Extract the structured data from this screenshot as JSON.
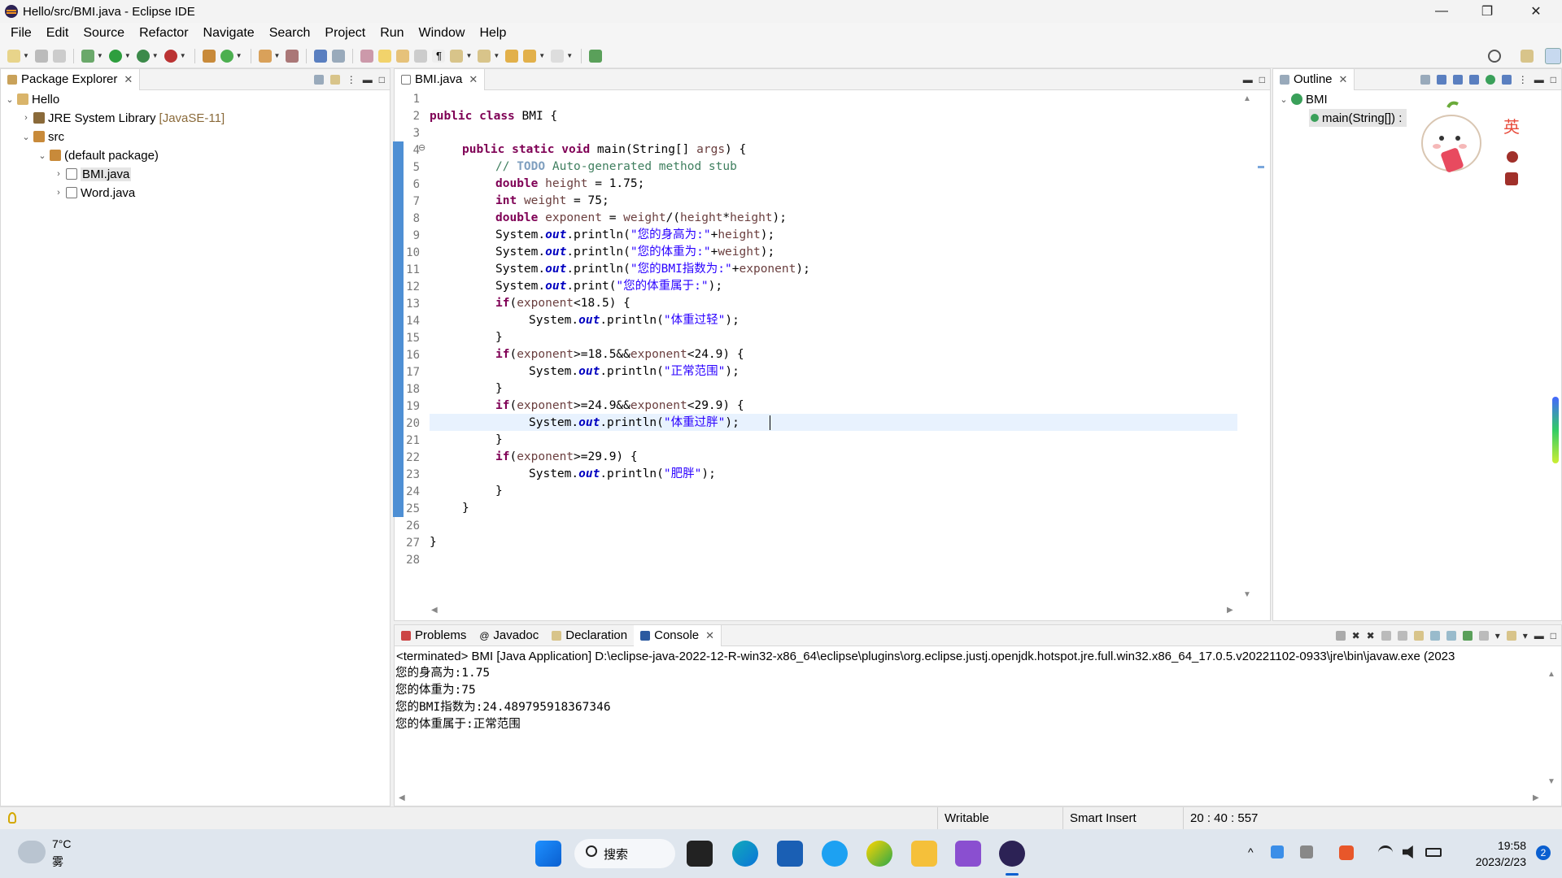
{
  "window": {
    "title": "Hello/src/BMI.java - Eclipse IDE",
    "minimize": "—",
    "restore": "❐",
    "close": "✕"
  },
  "menu": [
    "File",
    "Edit",
    "Source",
    "Refactor",
    "Navigate",
    "Search",
    "Project",
    "Run",
    "Window",
    "Help"
  ],
  "package_explorer": {
    "tab_label": "Package Explorer",
    "tree": [
      {
        "label": "Hello",
        "decoration": ""
      },
      {
        "label": "JRE System Library",
        "decoration": "[JavaSE-11]"
      },
      {
        "label": "src",
        "decoration": ""
      },
      {
        "label": "(default package)",
        "decoration": ""
      },
      {
        "label": "BMI.java",
        "decoration": ""
      },
      {
        "label": "Word.java",
        "decoration": ""
      }
    ]
  },
  "editor": {
    "tab_label": "BMI.java",
    "line_numbers": [
      "1",
      "2",
      "3",
      "4",
      "5",
      "6",
      "7",
      "8",
      "9",
      "10",
      "11",
      "12",
      "13",
      "14",
      "15",
      "16",
      "17",
      "18",
      "19",
      "20",
      "21",
      "22",
      "23",
      "24",
      "25",
      "26",
      "27",
      "28"
    ],
    "fold_marker": "⊖",
    "code": {
      "l2": [
        "public",
        "class",
        "BMI {"
      ],
      "l4": [
        "public",
        "static",
        "void",
        "main(String[] ",
        "args",
        ") {"
      ],
      "l5": [
        "// ",
        "TODO",
        " Auto-generated method stub"
      ],
      "l6": [
        "double",
        "height",
        " = 1.75;"
      ],
      "l7": [
        "int",
        "weight",
        " = 75;"
      ],
      "l8": [
        "double",
        "exponent",
        " = ",
        "weight",
        "/(",
        "height",
        "*",
        "height",
        ");"
      ],
      "l9": [
        "System.",
        "out",
        ".println(",
        "\"您的身高为:\"",
        "+",
        "height",
        ");"
      ],
      "l10": [
        "System.",
        "out",
        ".println(",
        "\"您的体重为:\"",
        "+",
        "weight",
        ");"
      ],
      "l11": [
        "System.",
        "out",
        ".println(",
        "\"您的BMI指数为:\"",
        "+",
        "exponent",
        ");"
      ],
      "l12": [
        "System.",
        "out",
        ".print(",
        "\"您的体重属于:\"",
        ");"
      ],
      "l13": [
        "if",
        "(",
        "exponent",
        "<18.5) {"
      ],
      "l14": [
        "System.",
        "out",
        ".println(",
        "\"体重过轻\"",
        ");"
      ],
      "l15": "}",
      "l16": [
        "if",
        "(",
        "exponent",
        ">=18.5&&",
        "exponent",
        "<24.9) {"
      ],
      "l17": [
        "System.",
        "out",
        ".println(",
        "\"正常范围\"",
        ");"
      ],
      "l18": "}",
      "l19": [
        "if",
        "(",
        "exponent",
        ">=24.9&&",
        "exponent",
        "<29.9) {"
      ],
      "l20": [
        "System.",
        "out",
        ".println(",
        "\"体重过胖\"",
        ");"
      ],
      "l21": "}",
      "l22": [
        "if",
        "(",
        "exponent",
        ">=29.9) {"
      ],
      "l23": [
        "System.",
        "out",
        ".println(",
        "\"肥胖\"",
        ");"
      ],
      "l24": "}",
      "l25": "}",
      "l27": "}"
    }
  },
  "outline": {
    "tab_label": "Outline",
    "class_name": "BMI",
    "method": "main(String[]) :",
    "ime_label": "英"
  },
  "bottom_tabs": {
    "problems": "Problems",
    "javadoc": "Javadoc",
    "declaration": "Declaration",
    "console": "Console"
  },
  "console": {
    "header": "<terminated> BMI [Java Application] D:\\eclipse-java-2022-12-R-win32-x86_64\\eclipse\\plugins\\org.eclipse.justj.openjdk.hotspot.jre.full.win32.x86_64_17.0.5.v20221102-0933\\jre\\bin\\javaw.exe  (2023",
    "lines": [
      "您的身高为:1.75",
      "您的体重为:75",
      "您的BMI指数为:24.489795918367346",
      "您的体重属于:正常范围"
    ]
  },
  "status": {
    "writable": "Writable",
    "insert_mode": "Smart Insert",
    "position": "20 : 40 : 557"
  },
  "taskbar": {
    "temperature": "7°C",
    "weather": "雾",
    "search": "搜索",
    "time": "19:58",
    "date": "2023/2/23",
    "notification_count": "2"
  }
}
